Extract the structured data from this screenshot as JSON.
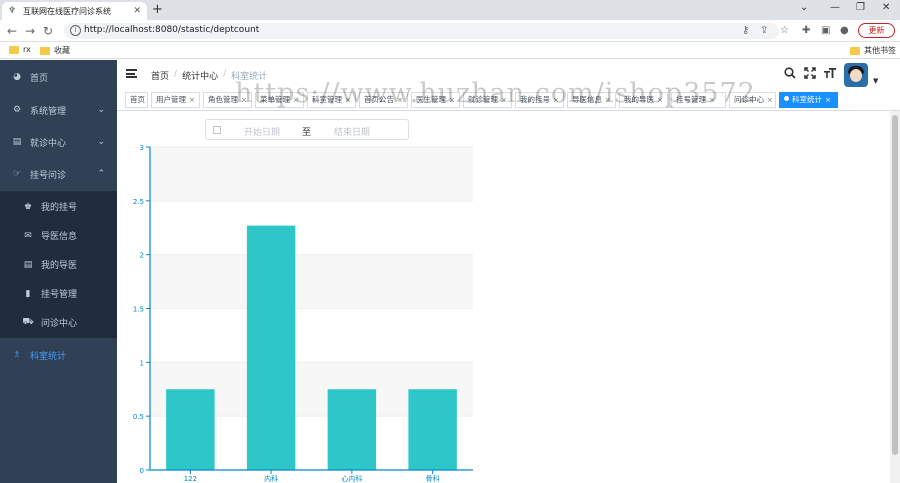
{
  "browser": {
    "tab_title": "互联网在线医疗问诊系统",
    "new_tab": "+",
    "url": "http://localhost:8080/stastic/deptcount",
    "update_label": "更新",
    "bookmarks": [
      "rx",
      "收藏"
    ],
    "other_bookmarks": "其他书签"
  },
  "sidebar": {
    "items": [
      {
        "label": "首页",
        "icon": "dashboard-icon"
      },
      {
        "label": "系统管理",
        "icon": "gear-icon"
      },
      {
        "label": "就诊中心",
        "icon": "document-icon"
      },
      {
        "label": "挂号问诊",
        "icon": "hand-icon"
      }
    ],
    "submenu": [
      {
        "label": "我的挂号",
        "icon": "shirt-icon"
      },
      {
        "label": "导医信息",
        "icon": "mail-icon"
      },
      {
        "label": "我的导医",
        "icon": "list-icon"
      },
      {
        "label": "挂号管理",
        "icon": "book-icon"
      },
      {
        "label": "问诊中心",
        "icon": "cart-icon"
      }
    ],
    "active_item": {
      "label": "科室统计",
      "icon": "chart-icon"
    },
    "active_color": "#409eff"
  },
  "header": {
    "breadcrumb": [
      "首页",
      "统计中心",
      "科室统计"
    ],
    "breadcrumb_sep": "/"
  },
  "tags": [
    {
      "label": "首页",
      "closable": false,
      "active": false
    },
    {
      "label": "用户管理",
      "closable": true,
      "active": false
    },
    {
      "label": "角色管理",
      "closable": true,
      "active": false
    },
    {
      "label": "菜单管理",
      "closable": true,
      "active": false
    },
    {
      "label": "科室管理",
      "closable": true,
      "active": false
    },
    {
      "label": "首页公告",
      "closable": true,
      "active": false
    },
    {
      "label": "医生管理",
      "closable": true,
      "active": false
    },
    {
      "label": "就诊管理",
      "closable": true,
      "active": false
    },
    {
      "label": "我的挂号",
      "closable": true,
      "active": false
    },
    {
      "label": "导医信息",
      "closable": true,
      "active": false
    },
    {
      "label": "我的导医",
      "closable": true,
      "active": false
    },
    {
      "label": "挂号管理",
      "closable": true,
      "active": false
    },
    {
      "label": "问诊中心",
      "closable": true,
      "active": false
    },
    {
      "label": "科室统计",
      "closable": true,
      "active": true
    }
  ],
  "datepicker": {
    "start_placeholder": "开始日期",
    "separator": "至",
    "end_placeholder": "结束日期"
  },
  "watermark": "https://www.huzhan.com/ishop3572",
  "chart_data": {
    "type": "bar",
    "categories": [
      "122",
      "内科",
      "心内科",
      "骨科"
    ],
    "values": [
      0.75,
      2.27,
      0.75,
      0.75
    ],
    "yticks": [
      "0",
      "0.5",
      "1",
      "1.5",
      "2",
      "2.5",
      "3"
    ],
    "ylim": [
      0,
      3
    ],
    "bar_color": "#2ec7c9",
    "axis_color": "#008acd",
    "grid": true
  }
}
